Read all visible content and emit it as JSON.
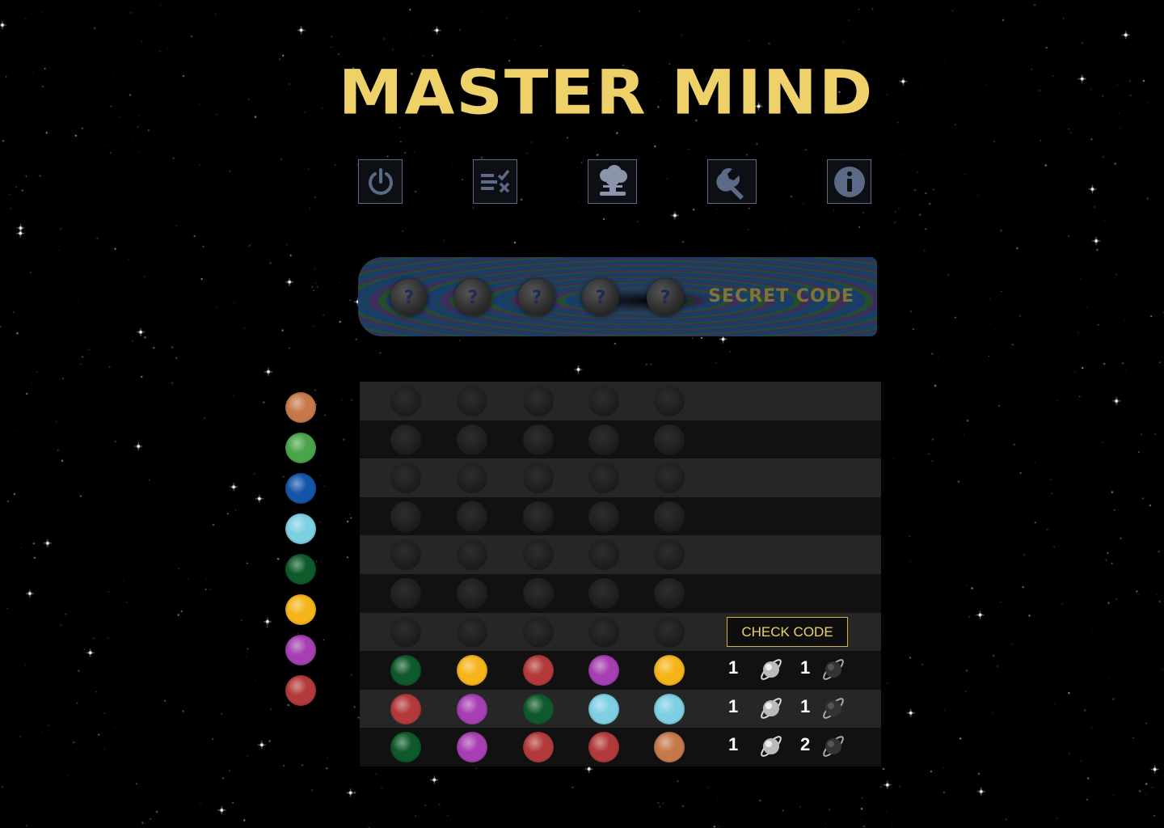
{
  "title": "MASTER MIND",
  "toolbar": [
    {
      "name": "power-icon-button",
      "icon": "power-icon"
    },
    {
      "name": "rules-icon-button",
      "icon": "checklist-icon"
    },
    {
      "name": "bomb-icon-button",
      "icon": "explosion-icon"
    },
    {
      "name": "settings-icon-button",
      "icon": "wrench-icon"
    },
    {
      "name": "info-icon-button",
      "icon": "info-icon"
    }
  ],
  "secret": {
    "label": "SECRET CODE",
    "slots": [
      "?",
      "?",
      "?",
      "?",
      "?"
    ]
  },
  "colors": {
    "orange": "#c7784b",
    "lightgreen": "#4aa54a",
    "blue": "#1455a7",
    "cyan": "#7fcfe3",
    "darkgreen": "#0e5a2a",
    "yellow": "#f5b41a",
    "purple": "#a63fb3",
    "red": "#b23a3a",
    "accent": "#efd16a"
  },
  "palette": [
    "orange",
    "lightgreen",
    "blue",
    "cyan",
    "darkgreen",
    "yellow",
    "purple",
    "red"
  ],
  "board": {
    "empty_rows": 7,
    "check_button": "CHECK CODE",
    "guesses": [
      {
        "pegs": [
          "darkgreen",
          "yellow",
          "red",
          "purple",
          "yellow"
        ],
        "exact": "1",
        "partial": "1"
      },
      {
        "pegs": [
          "red",
          "purple",
          "darkgreen",
          "cyan",
          "cyan"
        ],
        "exact": "1",
        "partial": "1"
      },
      {
        "pegs": [
          "darkgreen",
          "purple",
          "red",
          "red",
          "orange"
        ],
        "exact": "1",
        "partial": "2"
      }
    ]
  }
}
